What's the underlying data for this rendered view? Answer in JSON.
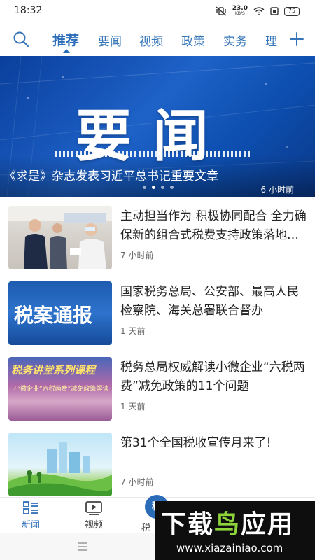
{
  "status_bar": {
    "time": "18:32",
    "net_speed": "23.0",
    "net_unit": "KB/S",
    "battery": "75"
  },
  "tabs": {
    "items": [
      "推荐",
      "要闻",
      "视频",
      "政策",
      "实务",
      "理"
    ],
    "active": "推荐",
    "accent": "#2a6cb8"
  },
  "banner": {
    "big_text": "要闻",
    "caption": "《求是》杂志发表习近平总书记重要文章",
    "time": "6 小时前",
    "pages": 4,
    "current_page": 1
  },
  "news": [
    {
      "title": "主动担当作为 积极协同配合 全力确保新的组合式税费支持政策落地见效",
      "time": "7 小时前"
    },
    {
      "title": "国家税务总局、公安部、最高人民检察院、海关总署联合督办",
      "time": "1 天前",
      "thumb_text": "税案通报"
    },
    {
      "title": "税务总局权威解读小微企业“六税两费”减免政策的11个问题",
      "time": "1 天前",
      "thumb_text": "税务讲堂系列课程",
      "thumb_sub": "小微企业“六税两费”减免政策解读"
    },
    {
      "title": "第31个全国税收宣传月来了!",
      "time": "7 小时前"
    }
  ],
  "bottom_nav": {
    "items": [
      {
        "label": "新闻",
        "icon": "grid-list-icon"
      },
      {
        "label": "视频",
        "icon": "play-video-icon"
      },
      {
        "label": "税",
        "icon": "tax-center-icon"
      }
    ]
  },
  "watermark": {
    "title_a": "下载",
    "title_b": "鸟",
    "title_c": "应用",
    "url": "www.xiazainiao.com"
  }
}
